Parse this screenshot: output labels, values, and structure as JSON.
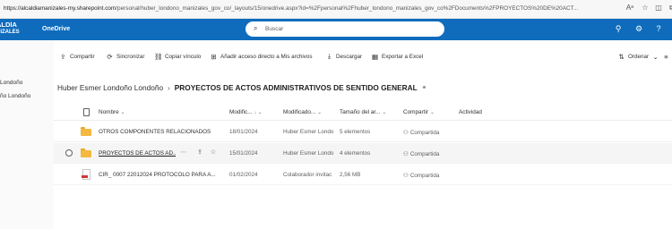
{
  "browser": {
    "url_host": "https://alcaldiamanizales-my.sharepoint.com",
    "url_path": "/personal/huber_londono_manizales_gov_co/_layouts/15/onedrive.aspx?id=%2Fpersonal%2Fhuber_londono_manizales_gov_co%2FDocuments%2FPROYECTOS%20DE%20ACT...",
    "icons": [
      "text-size-icon",
      "favorite-icon",
      "split-screen-icon",
      "collections-icon"
    ]
  },
  "suite": {
    "brand_line1": "ALDÍA",
    "brand_line2": "NIZALES",
    "app_name": "OneDrive",
    "search_placeholder": "Buscar",
    "colors": {
      "suite_bg": "#0f6cbd",
      "folder": "#f4b942",
      "pdf": "#d13438"
    }
  },
  "leftnav": {
    "items": [
      "Londoño",
      "ño Londoño"
    ]
  },
  "commands": {
    "share": "Compartir",
    "sync": "Sincronizar",
    "copy_link": "Copiar vínculo",
    "add_shortcut": "Añadir acceso directo a Mis archivos",
    "download": "Descargar",
    "export_excel": "Exportar a Excel",
    "sort": "Ordenar"
  },
  "breadcrumb": {
    "parent": "Huber Esmer Londoño Londoño",
    "separator": "›",
    "current": "PROYECTOS DE ACTOS ADMINISTRATIVOS DE SENTIDO GENERAL"
  },
  "table": {
    "headers": {
      "name": "Nombre",
      "modified": "Modific...",
      "modified_by": "Modificado...",
      "size": "Tamaño del ar...",
      "sharing": "Compartir",
      "activity": "Actividad"
    },
    "rows": [
      {
        "type": "folder",
        "name": "OTROS COMPONENTES RELACIONADOS",
        "modified": "18/01/2024",
        "modified_by": "Huber Esmer Londo",
        "size": "5 elementos",
        "sharing": "Compartida"
      },
      {
        "type": "folder",
        "name": "PROYECTOS DE ACTOS AD...",
        "modified": "15/01/2024",
        "modified_by": "Huber Esmer Londo",
        "size": "4 elementos",
        "sharing": "Compartida"
      },
      {
        "type": "pdf",
        "name": "CIR_ 0007 22012024 PROTOCOLO PARA A...",
        "modified": "01/02/2024",
        "modified_by": "Colaborador invitac",
        "size": "2,56 MB",
        "sharing": "Compartida"
      }
    ]
  }
}
